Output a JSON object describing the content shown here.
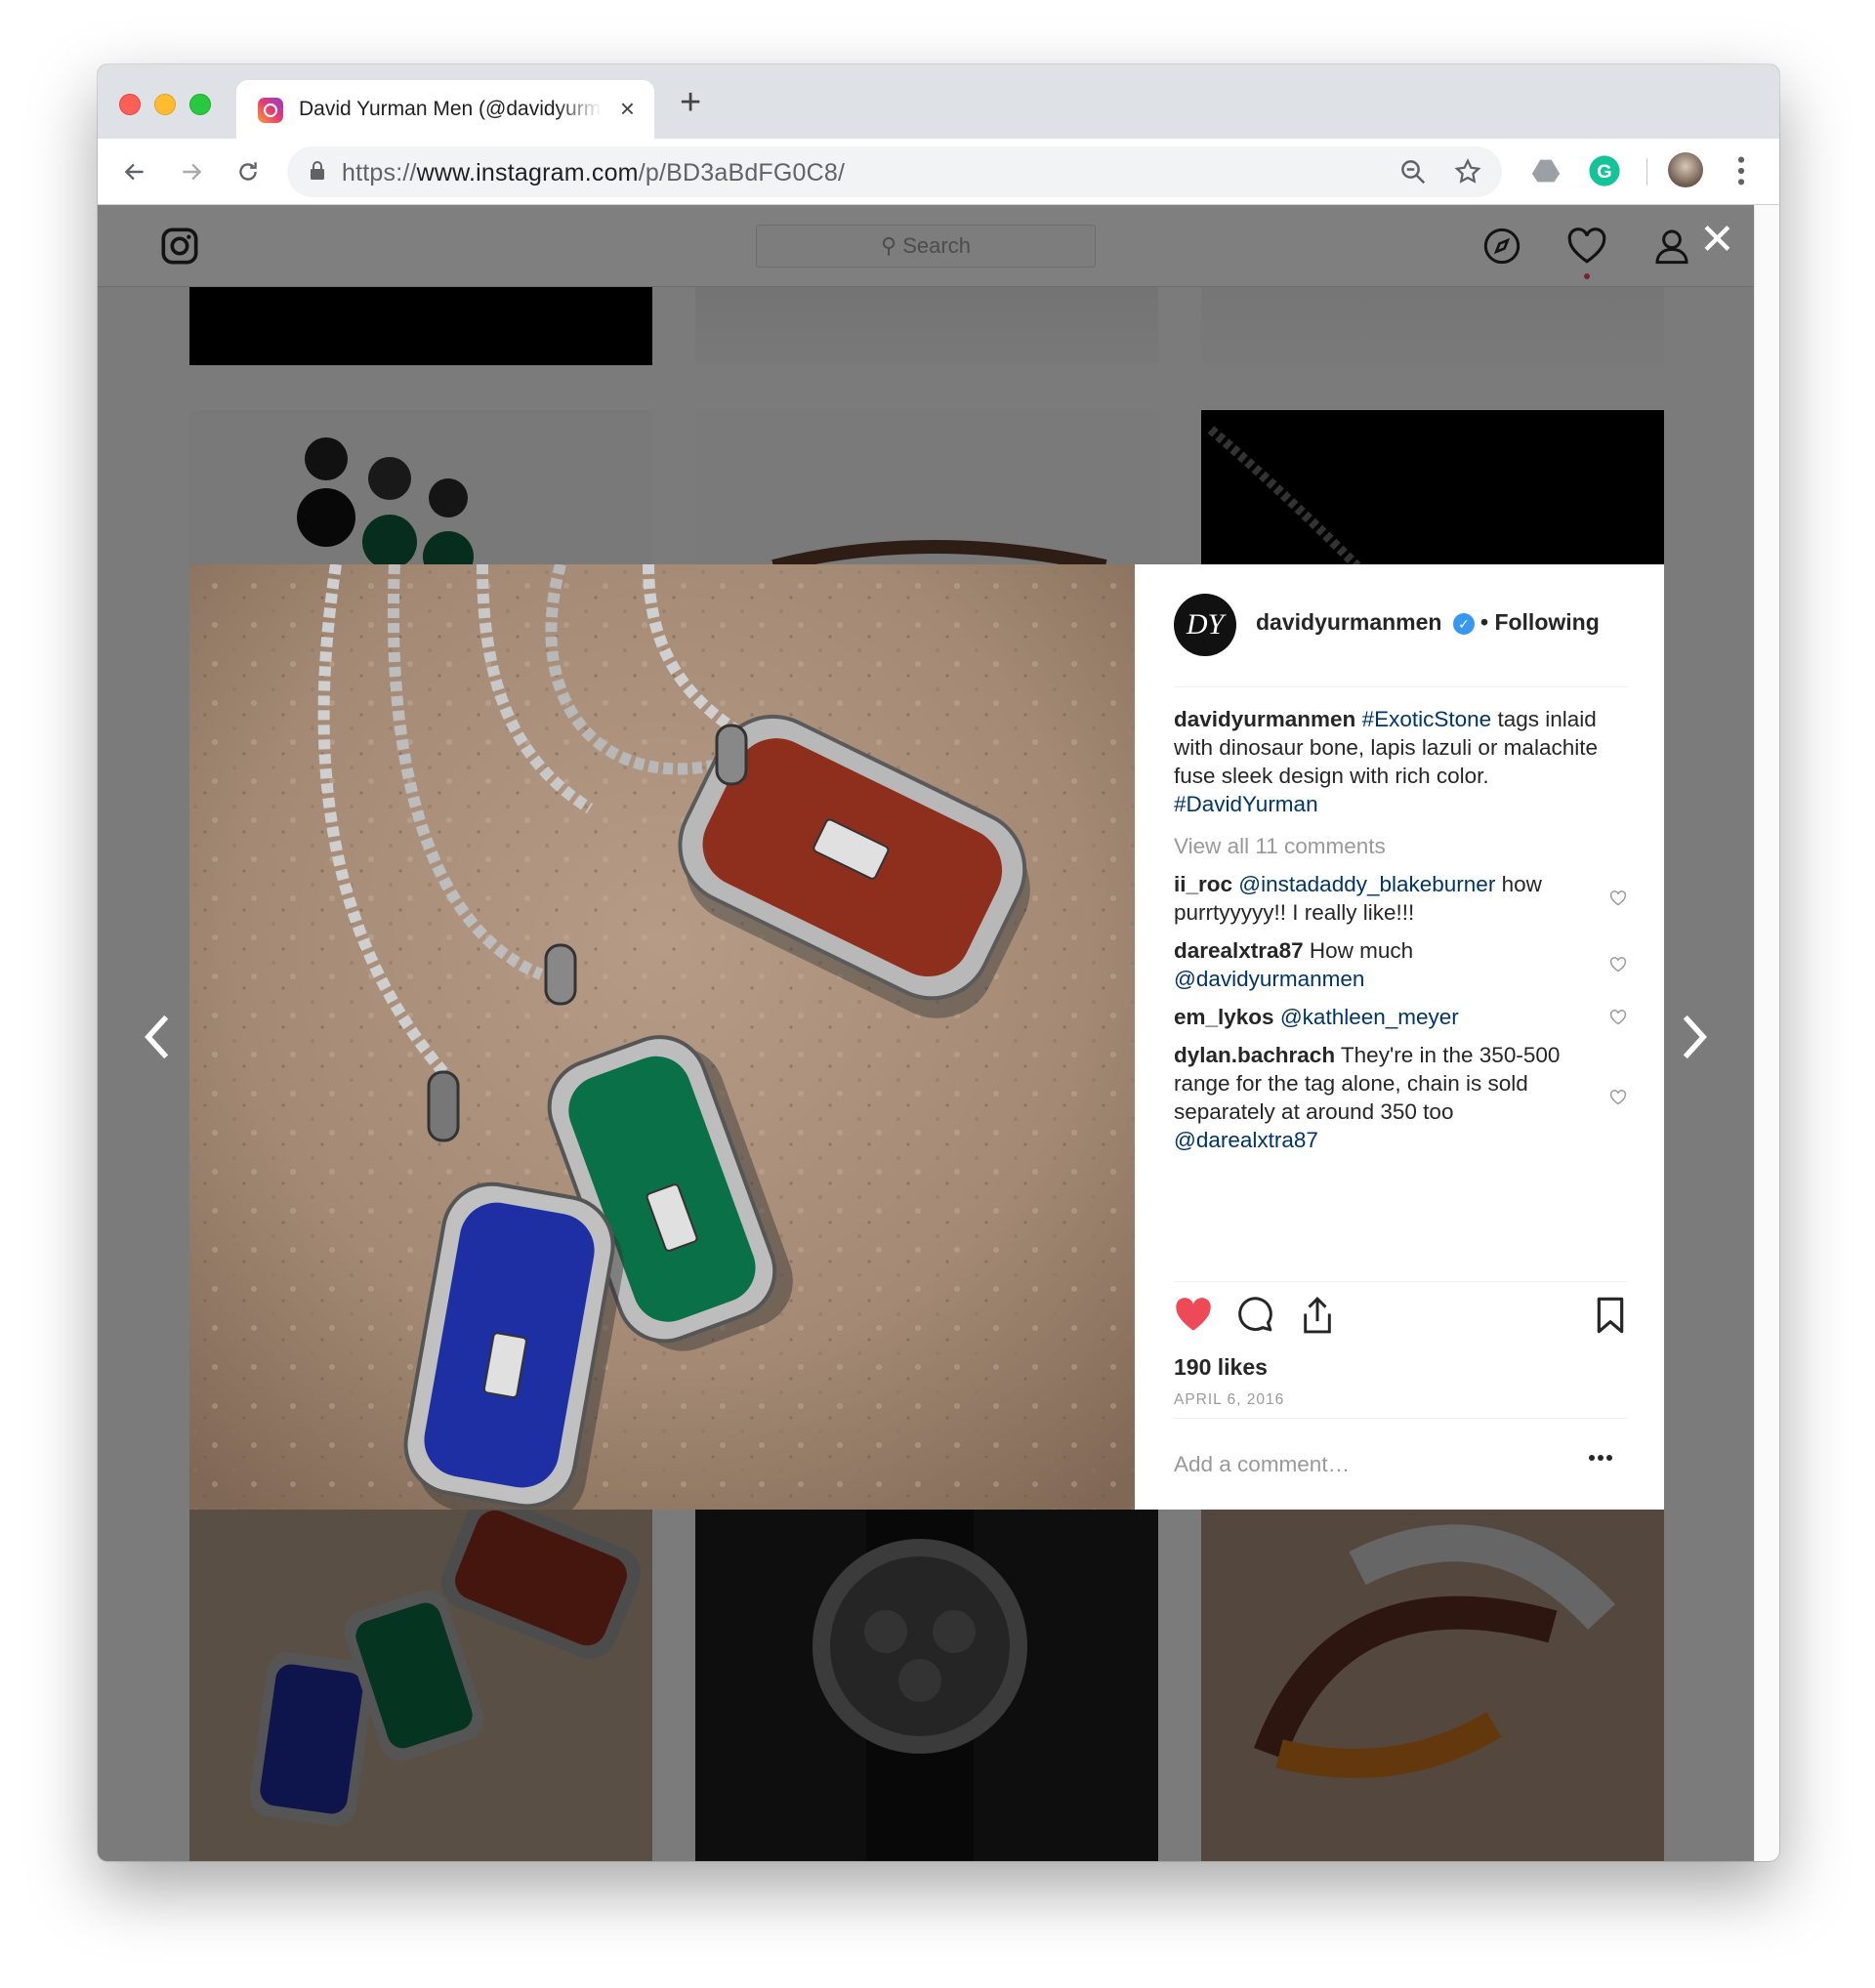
{
  "browser": {
    "tab_title": "David Yurman Men (@davidyurmanmen) on Instagram",
    "tab_close": "×",
    "new_tab": "+",
    "url_prefix": "https://",
    "url_host": "www.instagram.com",
    "url_path": "/p/BD3aBdFG0C8/"
  },
  "instagram": {
    "search_placeholder": "Search",
    "close": "✕"
  },
  "post": {
    "avatar_text": "DY",
    "username": "davidyurmanmen",
    "verified_mark": "✓",
    "follow_status": "• Following",
    "caption_user": "davidyurmanmen",
    "caption_tag1": "#ExoticStone",
    "caption_text": "tags inlaid with dinosaur bone, lapis lazuli or malachite fuse sleek design with rich color.",
    "caption_tag2": "#DavidYurman",
    "view_all": "View all 11 comments",
    "comments": [
      {
        "user": "ii_roc",
        "mention": "@instadaddy_blakeburner",
        "text": "how purrtyyyyy!! I really like!!!"
      },
      {
        "user": "darealxtra87",
        "text": "How much",
        "mention": "@davidyurmanmen"
      },
      {
        "user": "em_lykos",
        "mention": "@kathleen_meyer"
      },
      {
        "user": "dylan.bachrach",
        "text": "They're in the 350-500 range for the tag alone, chain is sold separately at around 350 too",
        "mention": "@darealxtra87"
      }
    ],
    "likes": "190 likes",
    "date": "APRIL 6, 2016",
    "add_comment_placeholder": "Add a comment…"
  },
  "colors": {
    "like_red": "#ed4956",
    "link_blue": "#003569",
    "verified_blue": "#3897f0"
  },
  "icons": [
    "instagram-logo-icon",
    "explore-compass-icon",
    "activity-heart-icon",
    "profile-icon",
    "close-icon",
    "chevron-left-icon",
    "chevron-right-icon",
    "like-heart-icon",
    "comment-icon",
    "share-icon",
    "bookmark-icon",
    "more-options-icon"
  ]
}
